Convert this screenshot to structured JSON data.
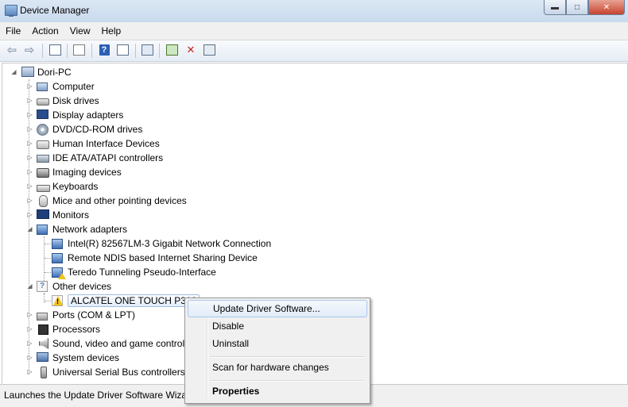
{
  "window": {
    "title": "Device Manager",
    "minimize": "▬",
    "maximize": "□",
    "close": "✕"
  },
  "menu": [
    "File",
    "Action",
    "View",
    "Help"
  ],
  "toolbar": {
    "icons": [
      "back-arrow-icon",
      "forward-arrow-icon",
      "show-hide-console-tree-icon",
      "properties-icon",
      "help-icon",
      "action-pane-icon",
      "scan-hardware-icon",
      "update-driver-icon",
      "uninstall-icon",
      "disable-icon"
    ]
  },
  "tree": {
    "root": "Dori-PC",
    "categories": [
      {
        "label": "Computer",
        "icon": "computer-icon"
      },
      {
        "label": "Disk drives",
        "icon": "disk-drive-icon"
      },
      {
        "label": "Display adapters",
        "icon": "display-adapter-icon"
      },
      {
        "label": "DVD/CD-ROM drives",
        "icon": "dvd-drive-icon"
      },
      {
        "label": "Human Interface Devices",
        "icon": "hid-icon"
      },
      {
        "label": "IDE ATA/ATAPI controllers",
        "icon": "ide-controller-icon"
      },
      {
        "label": "Imaging devices",
        "icon": "imaging-device-icon"
      },
      {
        "label": "Keyboards",
        "icon": "keyboard-icon"
      },
      {
        "label": "Mice and other pointing devices",
        "icon": "mouse-icon"
      },
      {
        "label": "Monitors",
        "icon": "monitor-icon"
      },
      {
        "label": "Network adapters",
        "icon": "network-adapter-icon",
        "expanded": true,
        "children": [
          {
            "label": "Intel(R) 82567LM-3 Gigabit Network Connection"
          },
          {
            "label": "Remote NDIS based Internet Sharing Device"
          },
          {
            "label": "Teredo Tunneling Pseudo-Interface",
            "warning": true
          }
        ]
      },
      {
        "label": "Other devices",
        "icon": "other-devices-icon",
        "expanded": true,
        "children": [
          {
            "label": "ALCATEL ONE TOUCH P310",
            "warning": true,
            "selected": true
          }
        ]
      },
      {
        "label": "Ports (COM & LPT)",
        "icon": "port-icon"
      },
      {
        "label": "Processors",
        "icon": "processor-icon"
      },
      {
        "label": "Sound, video and game controllers",
        "icon": "sound-icon"
      },
      {
        "label": "System devices",
        "icon": "system-device-icon"
      },
      {
        "label": "Universal Serial Bus controllers",
        "icon": "usb-icon"
      }
    ]
  },
  "context_menu": {
    "update": "Update Driver Software...",
    "disable": "Disable",
    "uninstall": "Uninstall",
    "scan": "Scan for hardware changes",
    "properties": "Properties"
  },
  "status": "Launches the Update Driver Software Wizard for the selected device."
}
